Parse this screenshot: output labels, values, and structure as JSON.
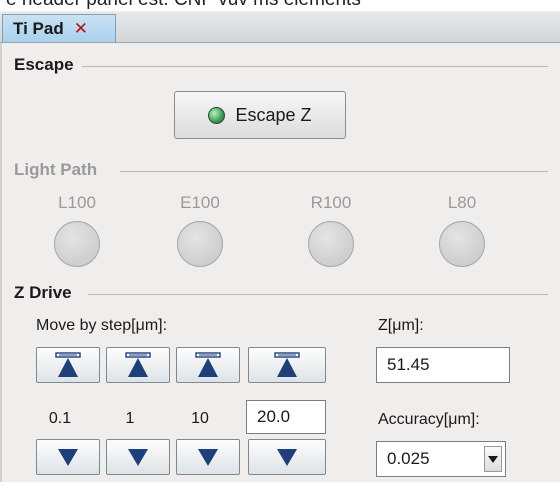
{
  "clipped_caption": "e header panel est. CNF vuv ms elements",
  "tab": {
    "label": "Ti Pad",
    "close_label": "✕"
  },
  "escape": {
    "title": "Escape",
    "button_label": "Escape Z"
  },
  "light_path": {
    "title": "Light Path",
    "options": [
      "L100",
      "E100",
      "R100",
      "L80"
    ]
  },
  "z_drive": {
    "title": "Z Drive",
    "move_label": "Move by step[μm]:",
    "steps": [
      "0.1",
      "1",
      "10"
    ],
    "custom_step": "20.0",
    "z_label": "Z[μm]:",
    "z_value": "51.45",
    "accuracy_label": "Accuracy[μm]:",
    "accuracy_value": "0.025"
  },
  "colors": {
    "tab_bg": "#bcdcf1",
    "led_green": "#3b9a55",
    "arrow_blue": "#1f3f7a"
  }
}
